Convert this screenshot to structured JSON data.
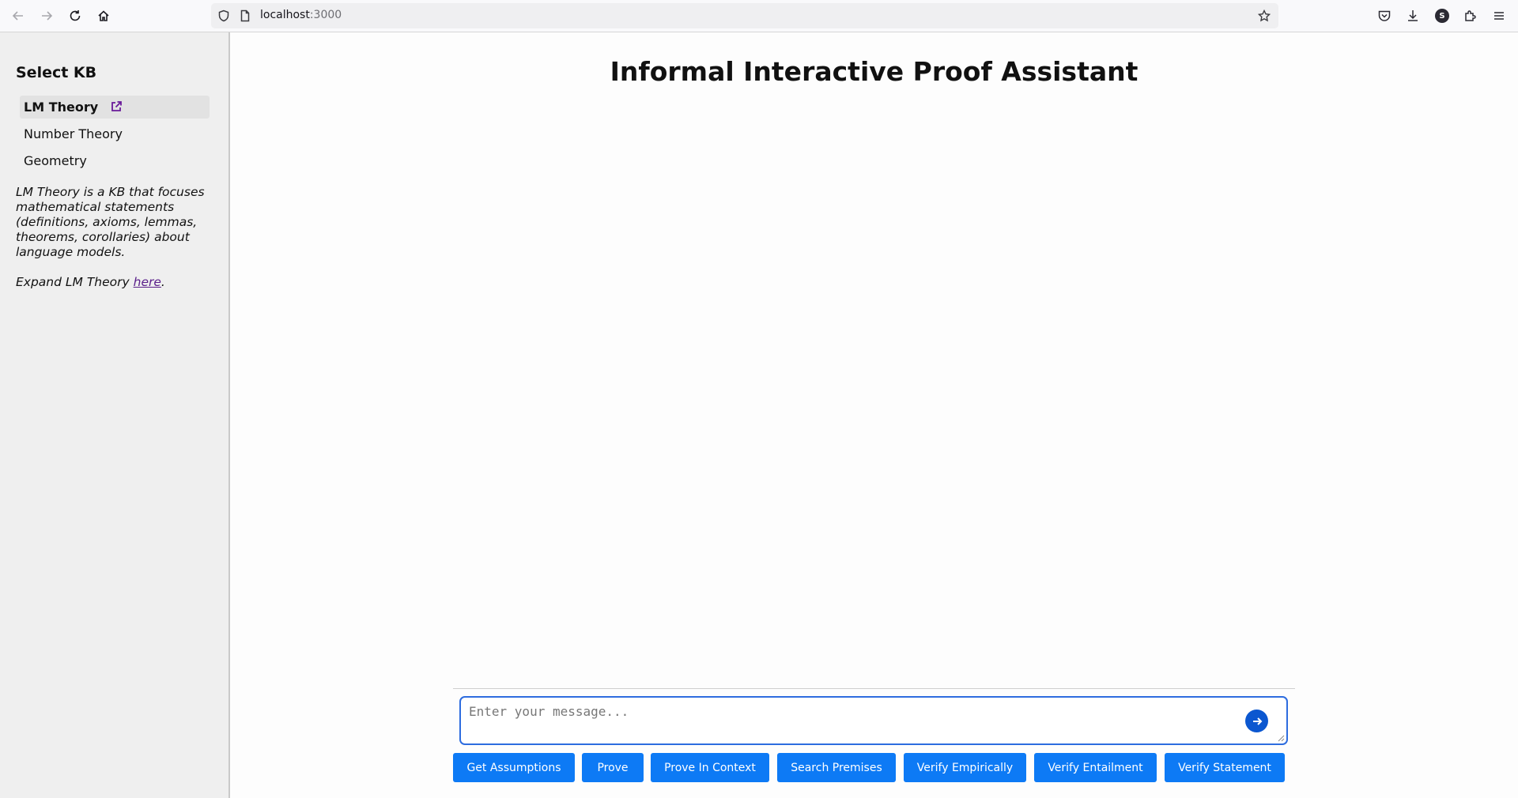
{
  "browser": {
    "url_host": "localhost",
    "url_port": ":3000",
    "avatar_letter": "S"
  },
  "sidebar": {
    "heading": "Select KB",
    "items": [
      {
        "label": "LM Theory",
        "active": true
      },
      {
        "label": "Number Theory",
        "active": false
      },
      {
        "label": "Geometry",
        "active": false
      }
    ],
    "description": "LM Theory is a KB that focuses mathematical statements (definitions, axioms, lemmas, theorems, corollaries) about language models.",
    "expand_prefix": "Expand LM Theory ",
    "expand_link": "here",
    "expand_suffix": "."
  },
  "main": {
    "title": "Informal Interactive Proof Assistant",
    "input_placeholder": "Enter your message...",
    "actions": [
      "Get Assumptions",
      "Prove",
      "Prove In Context",
      "Search Premises",
      "Verify Empirically",
      "Verify Entailment",
      "Verify Statement"
    ]
  },
  "colors": {
    "accent": "#0d7af5",
    "send": "#0b57d0",
    "link": "#5a1f8a"
  }
}
